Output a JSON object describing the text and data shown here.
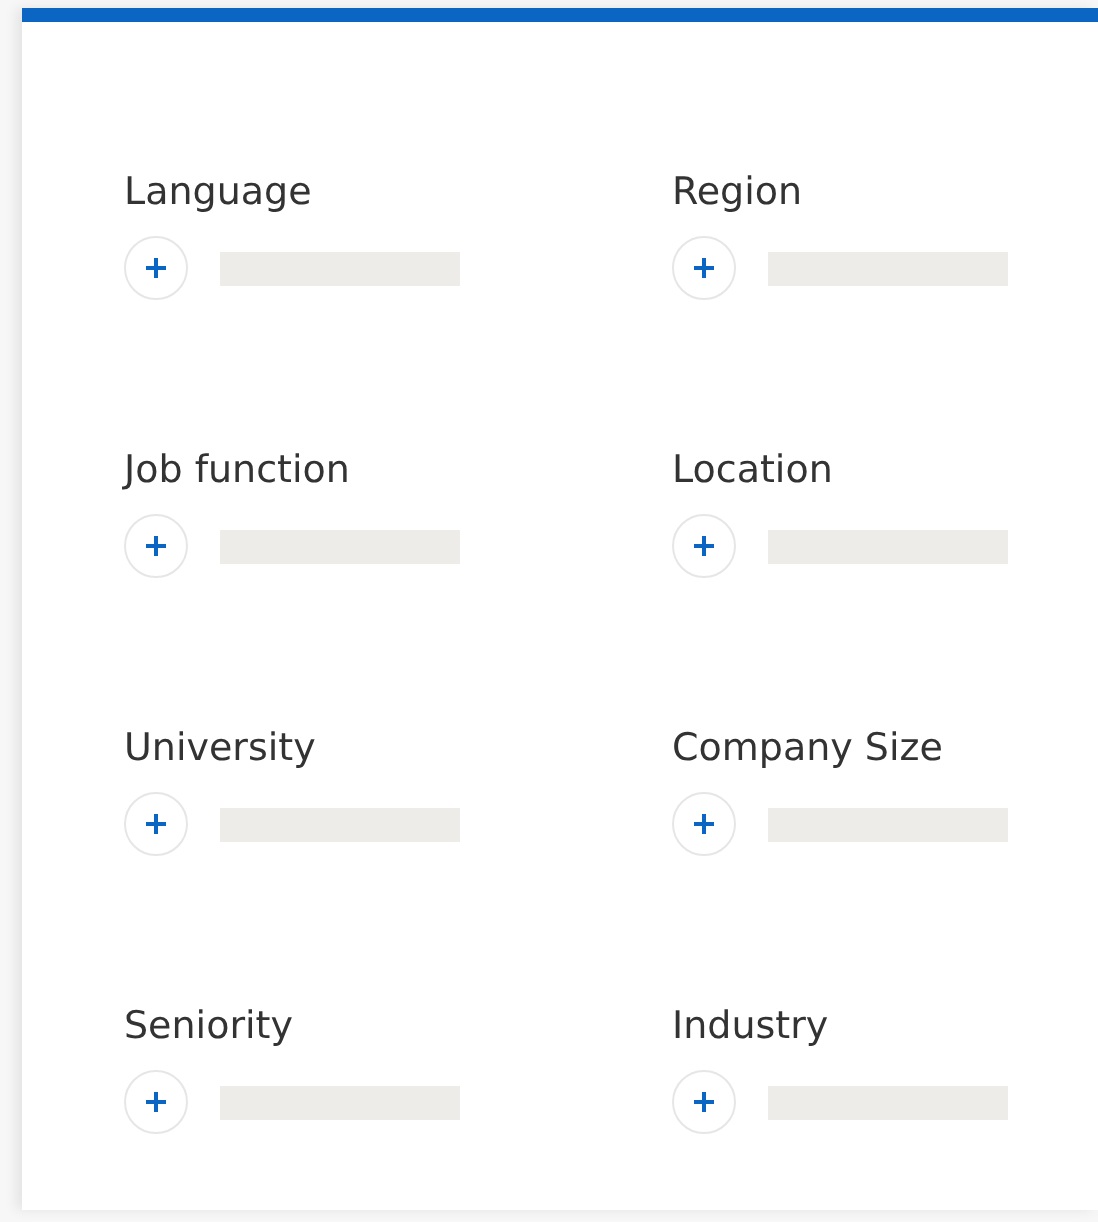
{
  "filters": [
    {
      "label": "Language"
    },
    {
      "label": "Region"
    },
    {
      "label": "Job function"
    },
    {
      "label": "Location"
    },
    {
      "label": "University"
    },
    {
      "label": "Company Size"
    },
    {
      "label": "Seniority"
    },
    {
      "label": "Industry"
    }
  ]
}
